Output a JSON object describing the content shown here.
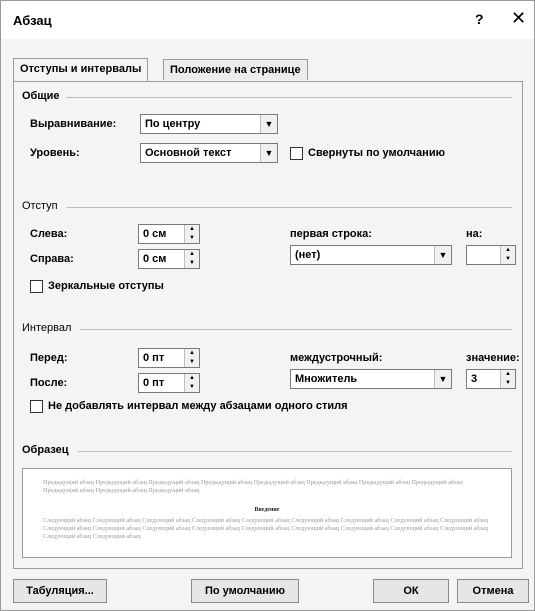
{
  "window": {
    "title": "Абзац",
    "help": "?",
    "close": "✕"
  },
  "tabs": [
    {
      "label": "Отступы и интервалы",
      "active": true
    },
    {
      "label": "Положение на странице",
      "active": false
    }
  ],
  "general": {
    "heading": "Общие",
    "alignment_label": "Выравнивание:",
    "alignment_value": "По центру",
    "level_label": "Уровень:",
    "level_value": "Основной текст",
    "collapsed_label": "Свернуты по умолчанию",
    "collapsed_checked": false
  },
  "indent": {
    "heading": "Отступ",
    "left_label": "Слева:",
    "left_value": "0 см",
    "right_label": "Справа:",
    "right_value": "0 см",
    "first_line_label": "первая строка:",
    "first_line_value": "(нет)",
    "by_label": "на:",
    "by_value": "",
    "mirror_label": "Зеркальные отступы",
    "mirror_checked": false
  },
  "spacing": {
    "heading": "Интервал",
    "before_label": "Перед:",
    "before_value": "0 пт",
    "after_label": "После:",
    "after_value": "0 пт",
    "line_label": "междустрочный:",
    "line_value": "Множитель",
    "at_label": "значение:",
    "at_value": "3",
    "no_space_label": "Не добавлять интервал между абзацами одного стиля",
    "no_space_checked": false
  },
  "preview": {
    "heading": "Образец",
    "prev_text": "Предыдущий абзац Предыдущий абзац Предыдущий абзац Предыдущий абзац Предыдущий абзац Предыдущий абзац Предыдущий абзац Предыдущий абзац Предыдущий абзац Предыдущий абзац Предыдущий абзац",
    "sample_text": "Введение",
    "next_text": "Следующий абзац Следующий абзац Следующий абзац Следующий абзац Следующий абзац Следующий абзац Следующий абзац Следующий абзац Следующий абзац Следующий абзац Следующий абзац Следующий абзац Следующий абзац Следующий абзац Следующий абзац Следующий абзац Следующий абзац Следующий абзац Следующий абзац Следующий абзац"
  },
  "buttons": {
    "tabs": "Табуляция...",
    "default": "По умолчанию",
    "ok": "ОК",
    "cancel": "Отмена"
  }
}
